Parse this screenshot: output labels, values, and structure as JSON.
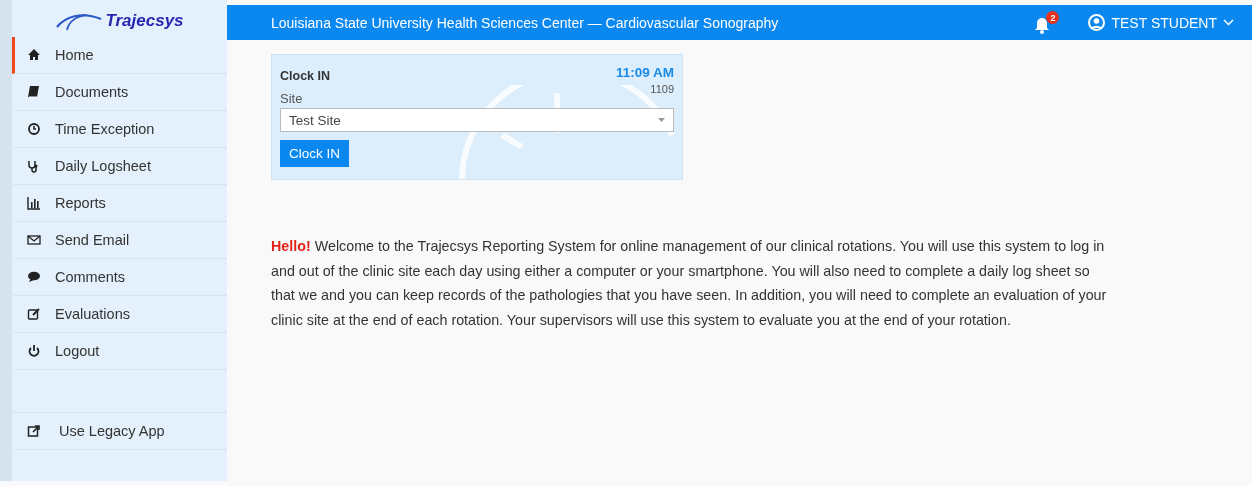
{
  "sidebar": {
    "brand": "Trajecsys",
    "items": [
      {
        "label": "Home",
        "selected": true
      },
      {
        "label": "Documents",
        "selected": false
      },
      {
        "label": "Time Exception",
        "selected": false
      },
      {
        "label": "Daily Logsheet",
        "selected": false
      },
      {
        "label": "Reports",
        "selected": false
      },
      {
        "label": "Send Email",
        "selected": false
      },
      {
        "label": "Comments",
        "selected": false
      },
      {
        "label": "Evaluations",
        "selected": false
      },
      {
        "label": "Logout",
        "selected": false
      }
    ],
    "legacy_link": "Use Legacy App"
  },
  "header": {
    "title": "Louisiana State University Health Sciences Center — Cardiovascular Sonography",
    "notification_count": "2",
    "user": "TEST STUDENT"
  },
  "clock_card": {
    "title": "Clock IN",
    "time": "11:09 AM",
    "code": "1109",
    "site_label": "Site",
    "site_value": "Test Site",
    "button": "Clock IN"
  },
  "welcome": {
    "greeting": "Hello!",
    "text": "Welcome to the Trajecsys Reporting System for online management of our clinical rotations. You will use this system to log in and out of the clinic site each day using either a computer or your smartphone. You will also need to complete a daily log sheet so that we and you can keep records of the pathologies that you have seen. In addition, you will need to complete an evaluation of your clinic site at the end of each rotation. Your supervisors will use this system to evaluate you at the end of your rotation."
  }
}
